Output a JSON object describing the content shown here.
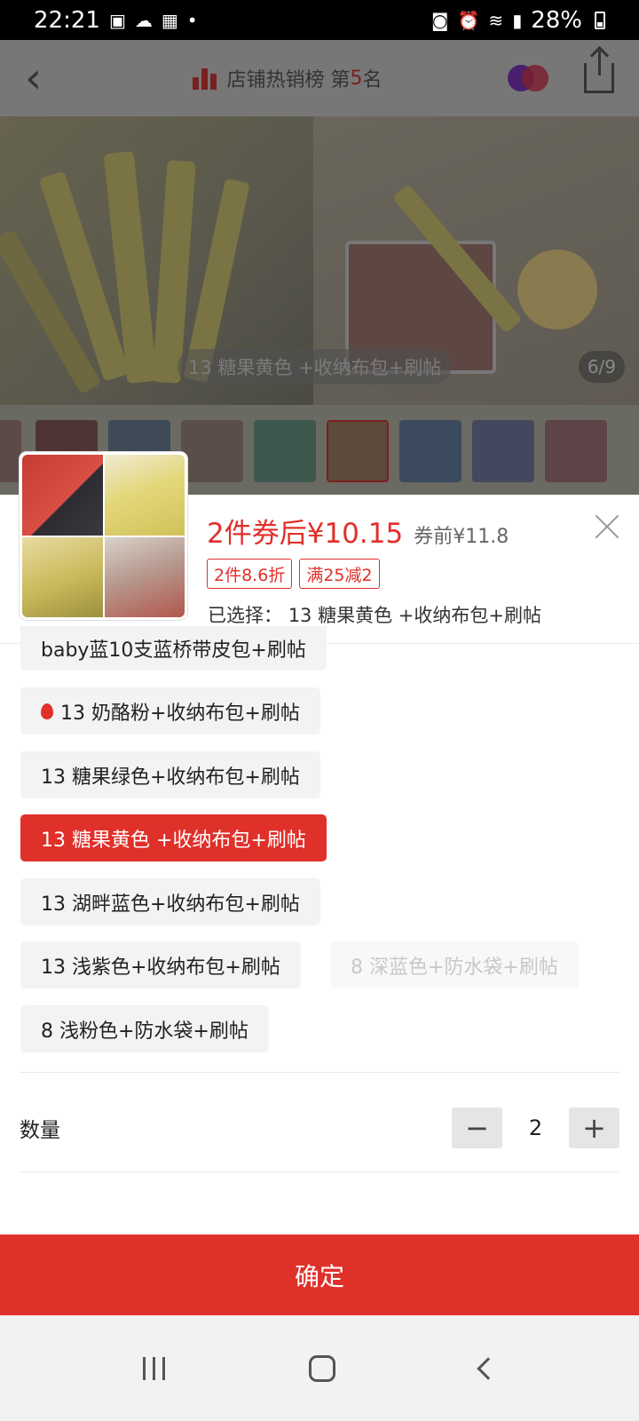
{
  "status_bar": {
    "time": "22:21",
    "battery": "28%",
    "icons": [
      "image-icon",
      "cloud-icon",
      "calendar-icon",
      "dot-icon",
      "nfc-icon",
      "alarm-icon",
      "wifi-icon",
      "signal-icon",
      "battery-icon"
    ]
  },
  "top_nav": {
    "rank_text": "店铺热销榜 第",
    "rank_number": "5",
    "rank_suffix": "名"
  },
  "gallery": {
    "caption": "13 糖果黄色 +收纳布包+刷帖",
    "counter": "6/9",
    "thumbnail_count": 9,
    "selected_thumbnail": 6
  },
  "sku_panel": {
    "price_label": "2件券后¥10.15",
    "pre_price": "券前¥11.8",
    "tags": [
      "2件8.6折",
      "满25减2"
    ],
    "selected_prefix": "已选择：",
    "selected_value": "13 糖果黄色 +收纳布包+刷帖"
  },
  "options": [
    {
      "label": "baby蓝10支蓝桥带皮包+刷帖",
      "state": "normal"
    },
    {
      "label": "13 奶酪粉+收纳布包+刷帖",
      "state": "normal",
      "hot": true
    },
    {
      "label": "13 糖果绿色+收纳布包+刷帖",
      "state": "normal"
    },
    {
      "label": "13 糖果黄色 +收纳布包+刷帖",
      "state": "selected"
    },
    {
      "label": "13 湖畔蓝色+收纳布包+刷帖",
      "state": "normal"
    },
    {
      "label": "13 浅紫色+收纳布包+刷帖",
      "state": "normal"
    },
    {
      "label": "8 深蓝色+防水袋+刷帖",
      "state": "disabled"
    },
    {
      "label": "8 浅粉色+防水袋+刷帖",
      "state": "normal"
    }
  ],
  "quantity": {
    "label": "数量",
    "minus": "−",
    "value": "2",
    "plus": "+"
  },
  "confirm_label": "确定",
  "colors": {
    "accent": "#e0302a",
    "overlay": "#6a6a62"
  }
}
